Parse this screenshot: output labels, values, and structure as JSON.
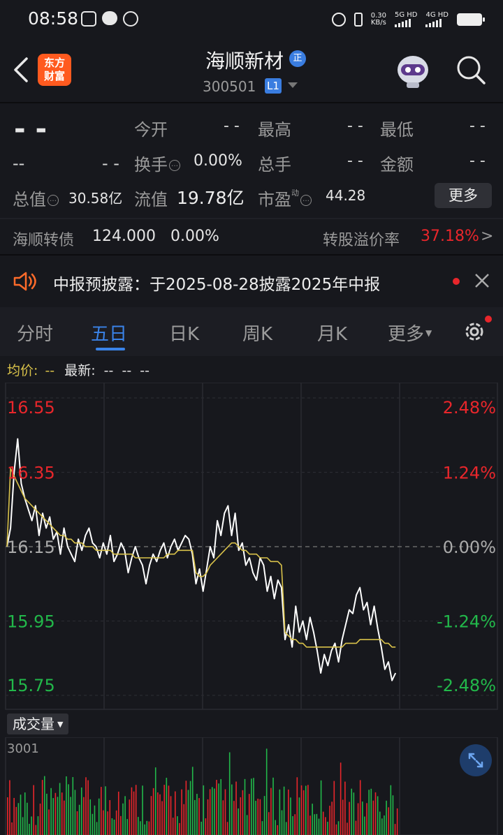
{
  "status_bar": {
    "time": "08:58",
    "net_speed_value": "0.30",
    "net_speed_unit": "KB/s",
    "sim1_label": "5G HD",
    "sim2_label": "4G HD",
    "icons": [
      "picture-icon",
      "chat-icon",
      "hand-icon",
      "alarm-icon",
      "vibrate-icon",
      "signal-icon",
      "battery-icon"
    ]
  },
  "header": {
    "logo_line1": "东方",
    "logo_line2": "财富",
    "stock_name": "海顺新材",
    "name_badge": "正",
    "stock_code": "300501",
    "level_badge": "L1"
  },
  "quote": {
    "price": "- -",
    "change": "--",
    "change_pct": "- -",
    "open_label": "今开",
    "open_value": "- -",
    "high_label": "最高",
    "high_value": "- -",
    "low_label": "最低",
    "low_value": "- -",
    "turnover_label": "换手",
    "turnover_value": "0.00%",
    "volume_label": "总手",
    "volume_value": "- -",
    "amount_label": "金额",
    "amount_value": "- -",
    "total_cap_label": "总值",
    "total_cap_value": "30.58亿",
    "float_cap_label": "流值",
    "float_cap_value": "19.78亿",
    "pe_label": "市盈",
    "pe_sup": "动",
    "pe_value": "44.28",
    "more_button": "更多"
  },
  "convertible": {
    "name": "海顺转债",
    "price": "124.000",
    "change_pct": "0.00%",
    "premium_label": "转股溢价率",
    "premium_value": "37.18%",
    "arrow": ">"
  },
  "notice": {
    "text": "中报预披露：于2025-08-28披露2025年中报"
  },
  "tabs": [
    {
      "label": "分时"
    },
    {
      "label": "五日"
    },
    {
      "label": "日K"
    },
    {
      "label": "周K"
    },
    {
      "label": "月K"
    },
    {
      "label": "更多"
    }
  ],
  "chart_header": {
    "avg_label": "均价:",
    "avg_value": "--",
    "latest_label": "最新:",
    "latest_values": "--  --  --"
  },
  "chart_data": {
    "type": "line",
    "days": 5,
    "ylim": [
      15.75,
      16.55
    ],
    "y_ticks_left": [
      "16.55",
      "16.35",
      "16.15",
      "15.95",
      "15.75"
    ],
    "y_ticks_right": [
      "2.48%",
      "1.24%",
      "0.00%",
      "-1.24%",
      "-2.48%"
    ],
    "prev_close": 16.15,
    "series": [
      {
        "values": [
          16.15,
          16.2,
          16.35,
          16.44,
          16.32,
          16.28,
          16.25,
          16.22,
          16.26,
          16.18,
          16.24,
          16.2,
          16.23,
          16.17,
          16.19,
          16.13,
          16.2,
          16.15,
          16.13,
          16.11,
          16.17,
          16.14,
          16.18,
          16.2,
          16.16,
          16.15,
          16.12,
          16.16,
          16.13,
          16.18,
          16.11,
          16.13,
          16.16,
          16.14,
          16.08,
          16.12,
          16.15,
          16.12,
          16.1,
          16.05,
          16.1,
          16.13,
          16.11,
          16.14,
          16.16,
          16.12,
          16.15,
          16.17,
          16.14,
          16.16,
          16.18,
          16.17,
          16.13,
          16.05,
          16.09,
          16.03,
          16.09,
          16.15,
          16.12,
          16.22,
          16.18,
          16.24,
          16.26,
          16.18,
          16.24,
          16.14,
          16.16,
          16.1,
          16.12,
          16.08,
          16.06,
          16.12,
          16.1,
          16.03,
          16.07,
          16.01,
          16.06,
          16.04,
          15.9,
          15.94,
          15.88,
          15.99,
          15.92,
          15.95,
          15.9,
          15.96,
          15.92,
          15.87,
          15.81,
          15.86,
          15.83,
          15.87,
          15.89,
          15.84,
          15.9,
          15.94,
          15.98,
          15.97,
          16.02,
          16.04,
          15.98,
          16.0,
          15.94,
          15.99,
          15.93,
          15.88,
          15.82,
          15.84,
          15.79,
          15.81
        ]
      },
      {
        "values": [
          16.15,
          16.36,
          16.34,
          16.32,
          16.3,
          16.28,
          16.27,
          16.26,
          16.25,
          16.24,
          16.23,
          16.22,
          16.21,
          16.2,
          16.19,
          16.18,
          16.18,
          16.17,
          16.17,
          16.16,
          16.16,
          16.16,
          16.15,
          16.15,
          16.15,
          16.14,
          16.14,
          16.14,
          16.14,
          16.14,
          16.13,
          16.13,
          16.13,
          16.13,
          16.13,
          16.13,
          16.12,
          16.12,
          16.12,
          16.12,
          16.12,
          16.12,
          16.12,
          16.12,
          16.12,
          16.13,
          16.13,
          16.13,
          16.14,
          16.14,
          16.14,
          16.14,
          16.14,
          16.08,
          16.07,
          16.07,
          16.08,
          16.1,
          16.11,
          16.12,
          16.13,
          16.14,
          16.15,
          16.16,
          16.16,
          16.15,
          16.14,
          16.14,
          16.13,
          16.13,
          16.13,
          16.12,
          16.12,
          16.12,
          16.11,
          16.11,
          16.11,
          16.1,
          15.92,
          15.91,
          15.9,
          15.9,
          15.89,
          15.89,
          15.88,
          15.88,
          15.88,
          15.88,
          15.88,
          15.88,
          15.88,
          15.88,
          15.88,
          15.88,
          15.88,
          15.89,
          15.89,
          15.89,
          15.89,
          15.9,
          15.9,
          15.9,
          15.9,
          15.9,
          15.9,
          15.9,
          15.89,
          15.89,
          15.88,
          15.88
        ]
      }
    ],
    "volume_label": "成交量",
    "volume_max_label": "3001"
  },
  "colors": {
    "up": "#e8262b",
    "down": "#22b84a",
    "price_line": "#ffffff",
    "avg_line": "#d9c24a",
    "accent": "#3a83e8",
    "brand": "#ff5a1f"
  }
}
